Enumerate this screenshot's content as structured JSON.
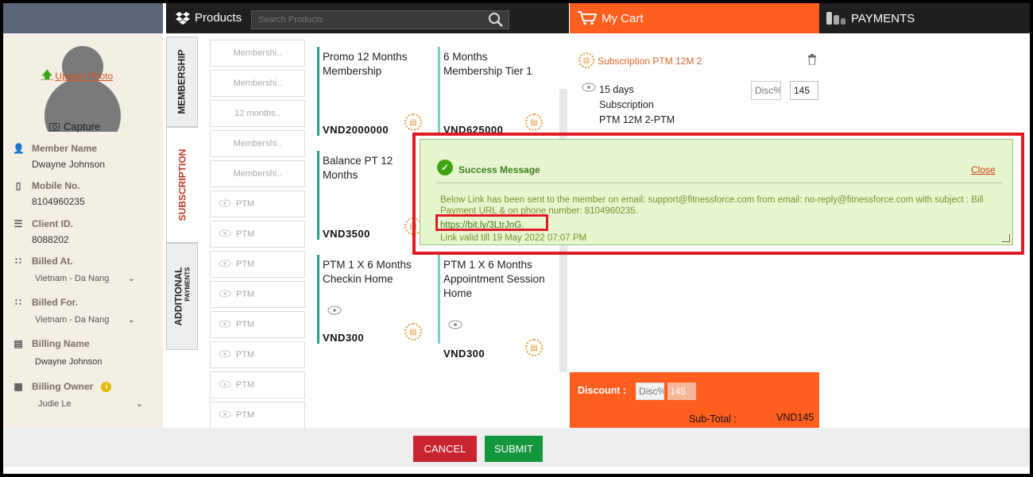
{
  "member": {
    "upload_photo": "Upload Photo",
    "capture": "Capture",
    "fields": [
      {
        "label": "Member Name",
        "value": "Dwayne Johnson"
      },
      {
        "label": "Mobile No.",
        "value": "8104960235"
      },
      {
        "label": "Client ID.",
        "value": "8088202"
      },
      {
        "label": "Billed At.",
        "value": "Vietnam - Da Nang"
      },
      {
        "label": "Billed For.",
        "value": "Vietnam - Da Nang"
      },
      {
        "label": "Billing Name",
        "value": "Dwayne  Johnson"
      },
      {
        "label": "Billing Owner",
        "value": "Judie Le"
      }
    ]
  },
  "header": {
    "products": "Products",
    "search_placeholder": "Search Products",
    "cart": "My Cart",
    "payments": "PAYMENTS"
  },
  "tabs": [
    {
      "label": "MEMBERSHIP",
      "active": false
    },
    {
      "label": "SUBSCRIPTION",
      "active": true
    },
    {
      "label": "ADDITIONAL",
      "sub": "PAYMENTS",
      "active": false
    }
  ],
  "categories": [
    "Membershi..",
    "Membershi..",
    "12 months..",
    "Membershi..",
    "Membershi..",
    "PTM",
    "PTM",
    "PTM",
    "PTM",
    "PTM",
    "PTM",
    "PTM",
    "PTM"
  ],
  "products": [
    {
      "name": "Promo 12 Months Membership",
      "price": "VND2000000"
    },
    {
      "name": "6 Months Membership Tier 1",
      "price": "VND625000"
    },
    {
      "name": "Balance PT 12 Months",
      "price": "VND3500"
    },
    {
      "name": "PTM 1 X 6 Months Checkin Home",
      "price": "VND300"
    },
    {
      "name": "PTM 1 X 6 Months Appointment Session Home",
      "price": "VND300"
    }
  ],
  "cart": {
    "item_name": "Subscription PTM 12M 2",
    "item_desc_1": "15 days",
    "item_desc_2": "Subscription",
    "item_desc_3": "PTM 12M 2-PTM",
    "disc_placeholder": "Disc%",
    "qty": "145",
    "discount_label": "Discount :",
    "footer_disc_placeholder": "Disc%",
    "footer_amount": "145",
    "subtotal_label": "Sub-Total   :",
    "subtotal_value": "VND145"
  },
  "success": {
    "title": "Success Message",
    "close": "Close",
    "message": "Below Link has been sent to the member on email: support@fitnessforce.com from email: no-reply@fitnessforce.com with subject : Bill Payment URL & on phone number: 8104960235.",
    "link": "https://bit.ly/3LtrJnG.",
    "valid": "Link valid till 19 May 2022 07:07 PM"
  },
  "actions": {
    "cancel": "CANCEL",
    "submit": "SUBMIT"
  },
  "colors": {
    "cart_orange": "#ff5e1f",
    "success_bg": "#e8f6d0",
    "highlight_red": "#e01b24",
    "cancel_red": "#c9242f",
    "submit_green": "#14963c"
  }
}
